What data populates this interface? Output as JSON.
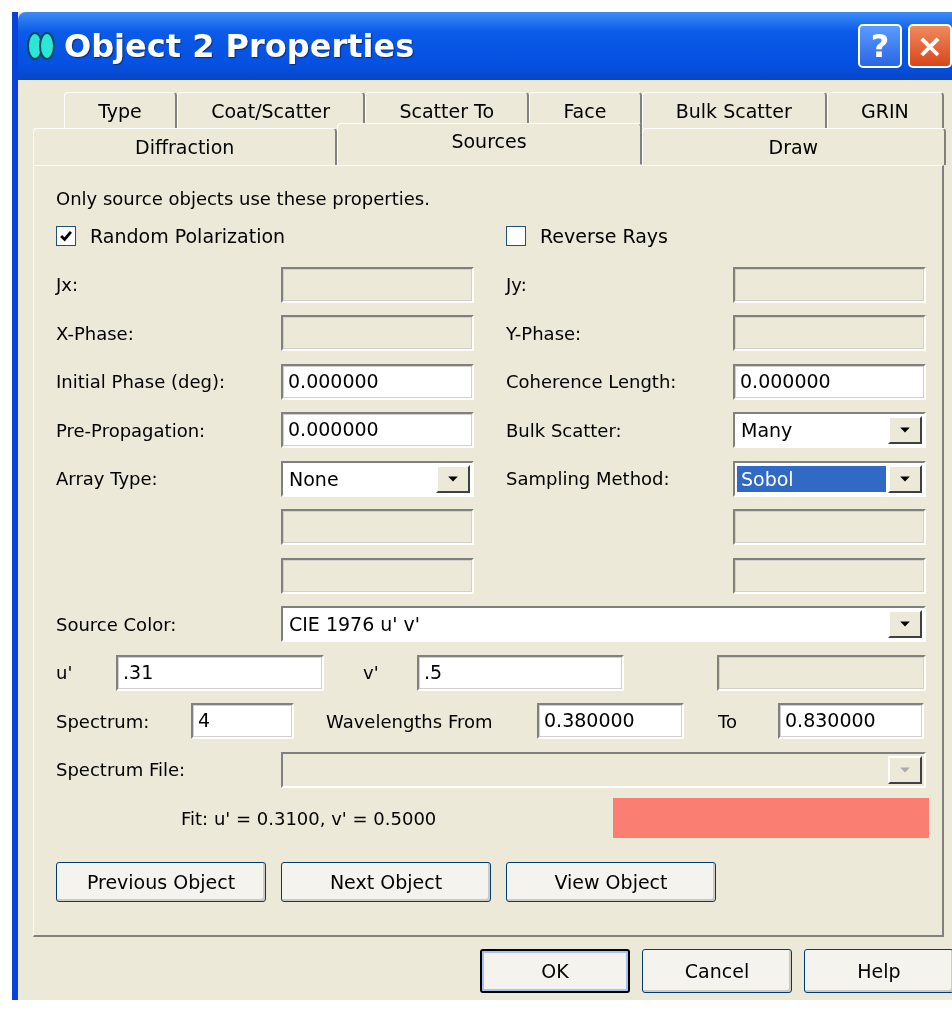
{
  "window": {
    "title": "Object 2 Properties",
    "help_button": "?",
    "close_button": "×"
  },
  "tab_rows": [
    [
      {
        "label": "Type",
        "selected": false
      },
      {
        "label": "Coat/Scatter",
        "selected": false
      },
      {
        "label": "Scatter To",
        "selected": false
      },
      {
        "label": "Face",
        "selected": false
      },
      {
        "label": "Bulk Scatter",
        "selected": false
      },
      {
        "label": "GRIN",
        "selected": false
      }
    ],
    [
      {
        "label": "Diffraction",
        "selected": false
      },
      {
        "label": "Sources",
        "selected": true
      },
      {
        "label": "Draw",
        "selected": false
      }
    ]
  ],
  "intro": "Only source objects use these properties.",
  "checkboxes": [
    {
      "label": "Random Polarization",
      "checked": true
    },
    {
      "label": "Reverse Rays",
      "checked": false
    }
  ],
  "rows": [
    {
      "left": {
        "label": "Jx:",
        "kind": "text",
        "disabled": true
      },
      "right": {
        "label": "Jy:",
        "kind": "text",
        "disabled": true
      }
    },
    {
      "left": {
        "label": "X-Phase:",
        "kind": "text",
        "disabled": true
      },
      "right": {
        "label": "Y-Phase:",
        "kind": "text",
        "disabled": true
      }
    },
    {
      "left": {
        "label": "Initial Phase (deg):",
        "kind": "text",
        "value": "0.000000",
        "disabled": false
      },
      "right": {
        "label": "Coherence Length:",
        "kind": "text",
        "value": "0.000000",
        "disabled": false
      }
    },
    {
      "left": {
        "label": "Pre-Propagation:",
        "kind": "text",
        "value": "0.000000",
        "disabled": false
      },
      "right": {
        "label": "Bulk Scatter:",
        "kind": "dropdown",
        "value": "Many",
        "disabled": false,
        "selected": false
      }
    },
    {
      "left": {
        "label": "Array Type:",
        "kind": "dropdown",
        "value": "None",
        "disabled": false,
        "selected": false
      },
      "right": {
        "label": "Sampling Method:",
        "kind": "dropdown",
        "value": "Sobol",
        "disabled": false,
        "selected": true
      }
    },
    {
      "left": {
        "kind": "text",
        "disabled": true
      },
      "right": {
        "kind": "text",
        "disabled": true
      }
    },
    {
      "left": {
        "kind": "text",
        "disabled": true
      },
      "right": {
        "kind": "text",
        "disabled": true
      }
    }
  ],
  "source_color": {
    "label": "Source Color:",
    "value": "CIE 1976 u' v'",
    "disabled": false
  },
  "uv": {
    "u_label": "u'",
    "u_value": ".31",
    "v_label": "v'",
    "v_value": ".5",
    "extra_disabled": true
  },
  "spectrum": {
    "label": "Spectrum:",
    "value": "4",
    "from_label": "Wavelengths From",
    "from_value": "0.380000",
    "to_label": "To",
    "to_value": "0.830000"
  },
  "spectrum_file": {
    "label": "Spectrum File:",
    "disabled": true
  },
  "fit": {
    "text": "Fit: u' = 0.3100, v' = 0.5000",
    "color": "#fa7f72"
  },
  "object_buttons": [
    "Previous Object",
    "Next Object",
    "View Object"
  ],
  "dialog_buttons": [
    {
      "label": "OK",
      "default": true
    },
    {
      "label": "Cancel",
      "default": false
    },
    {
      "label": "Help",
      "default": false
    }
  ]
}
